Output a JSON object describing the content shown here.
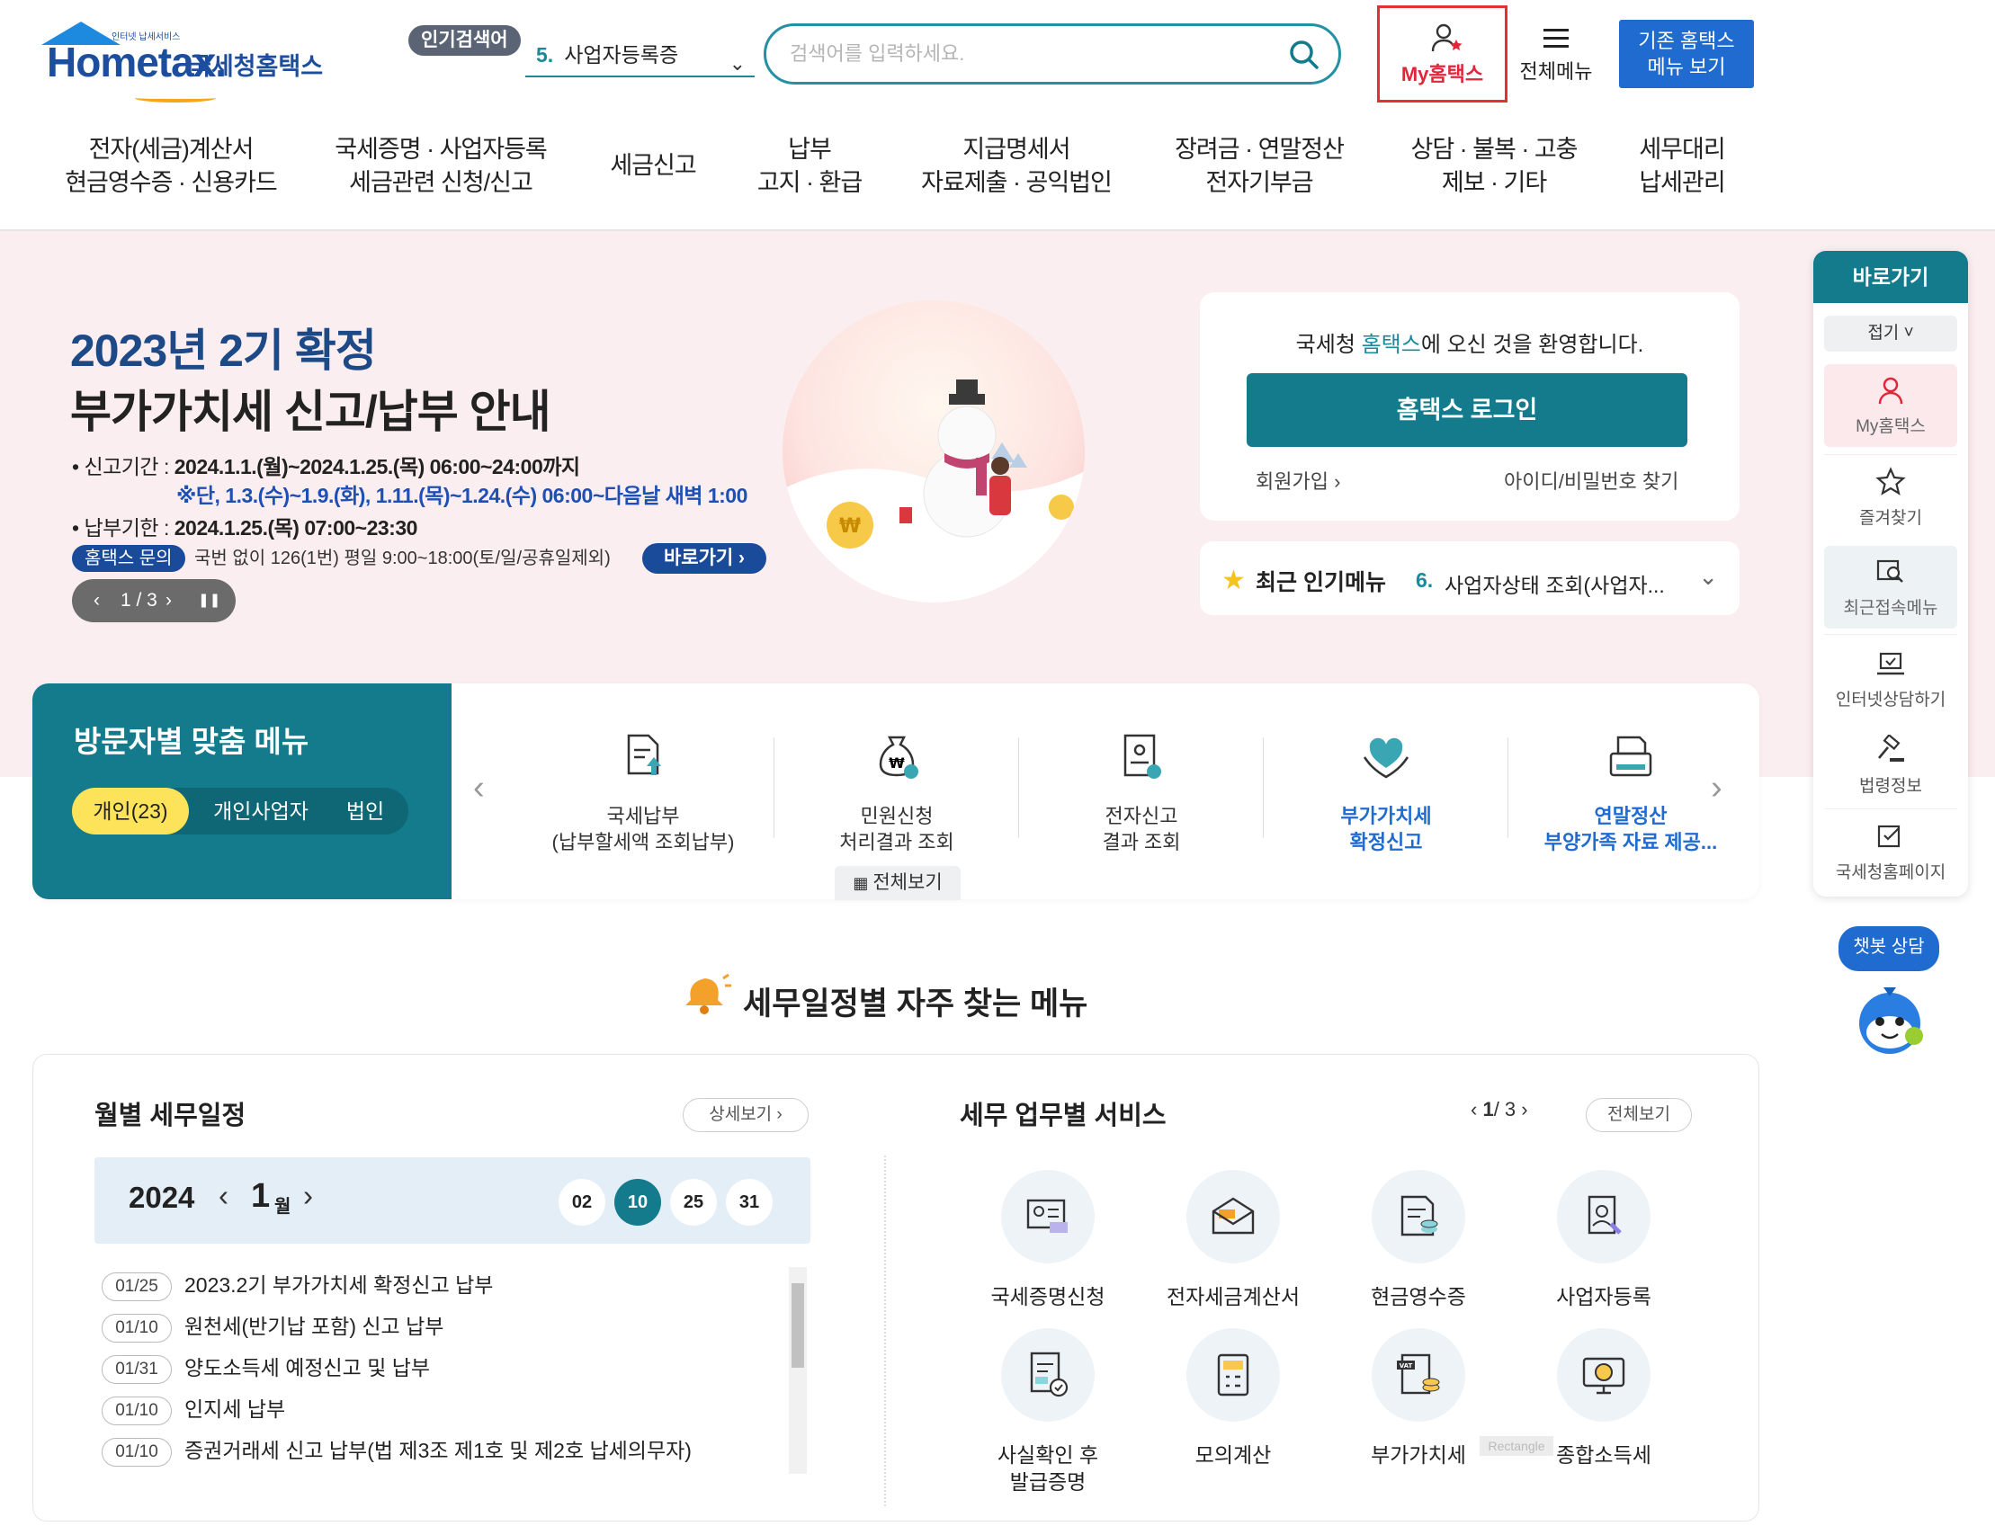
{
  "header": {
    "logo_brand": "Hometax.",
    "logo_sub": "국세청홈택스",
    "logo_tiny": "인터넷 납세서비스",
    "popular_badge": "인기검색어",
    "popular_num": "5.",
    "popular_text": "사업자등록증",
    "search_placeholder": "검색어를 입력하세요.",
    "my_hometax": "My홈택스",
    "all_menu": "전체메뉴",
    "old_menu_line1": "기존 홈택스",
    "old_menu_line2": "메뉴 보기"
  },
  "nav": [
    {
      "l1": "전자(세금)계산서",
      "l2": "현금영수증 · 신용카드"
    },
    {
      "l1": "국세증명 · 사업자등록",
      "l2": "세금관련 신청/신고"
    },
    {
      "l1": "세금신고",
      "l2": ""
    },
    {
      "l1": "납부",
      "l2": "고지 · 환급"
    },
    {
      "l1": "지급명세서",
      "l2": "자료제출 · 공익법인"
    },
    {
      "l1": "장려금 · 연말정산",
      "l2": "전자기부금"
    },
    {
      "l1": "상담 · 불복 · 고충",
      "l2": "제보 · 기타"
    },
    {
      "l1": "세무대리",
      "l2": "납세관리"
    }
  ],
  "hero": {
    "title1": "2023년 2기 확정",
    "title2": "부가가치세 신고/납부 안내",
    "line1_label": "• 신고기간 : ",
    "line1_value": "2024.1.1.(월)~2024.1.25.(목) 06:00~24:00까지",
    "line2": "※단, 1.3.(수)~1.9.(화), 1.11.(목)~1.24.(수) 06:00~다음날 새벽 1:00",
    "line3_label": "• 납부기한 : ",
    "line3_value": "2024.1.25.(목) 07:00~23:30",
    "inquiry_badge": "홈택스 문의",
    "inquiry_text": "국번 없이 126(1번) 평일 9:00~18:00(토/일/공휴일제외)",
    "goto": "바로가기 ›",
    "pager": "1 / 3",
    "pager_prev": "‹",
    "pager_next": "›",
    "pager_pause": "❚❚"
  },
  "login": {
    "welcome_pre": "국세청 ",
    "welcome_hl": "홈택스",
    "welcome_post": "에 오신 것을 환영합니다.",
    "button": "홈택스 로그인",
    "join": "회원가입 ›",
    "find": "아이디/비밀번호 찾기"
  },
  "recent_popular": {
    "title": "최근 인기메뉴",
    "num": "6.",
    "text": "사업자상태 조회(사업자..."
  },
  "visitor": {
    "title": "방문자별 맞춤 메뉴",
    "tabs": [
      "개인(23)",
      "개인사업자",
      "법인"
    ],
    "items": [
      {
        "l1": "국세납부",
        "l2": "(납부할세액 조회납부)",
        "icon": "tax-payment-icon"
      },
      {
        "l1": "민원신청",
        "l2": "처리결과 조회",
        "icon": "money-bag-icon"
      },
      {
        "l1": "전자신고",
        "l2": "결과 조회",
        "icon": "e-filing-icon"
      },
      {
        "l1": "부가가치세",
        "l2": "확정신고",
        "icon": "heart-hands-icon"
      },
      {
        "l1": "연말정산",
        "l2": "부양가족 자료 제공...",
        "icon": "printer-doc-icon"
      }
    ],
    "all": "전체보기",
    "prev": "‹",
    "next": "›"
  },
  "quickbar": {
    "title": "바로가기",
    "fold": "접기 ˅",
    "items": [
      "My홈택스",
      "즐겨찾기",
      "최근접속메뉴",
      "인터넷상담하기",
      "법령정보",
      "국세청홈페이지"
    ],
    "chatbot": "챗봇 상담"
  },
  "schedule_section": {
    "title": "세무일정별 자주 찾는 메뉴"
  },
  "calendar": {
    "title": "월별 세무일정",
    "detail": "상세보기 ›",
    "year": "2024",
    "month": "1",
    "month_unit": "월",
    "days": [
      "02",
      "10",
      "25",
      "31"
    ],
    "selected_day": "10",
    "events": [
      {
        "date": "01/25",
        "text": "2023.2기 부가가치세 확정신고 납부"
      },
      {
        "date": "01/10",
        "text": "원천세(반기납 포함) 신고 납부"
      },
      {
        "date": "01/31",
        "text": "양도소득세 예정신고 및 납부"
      },
      {
        "date": "01/10",
        "text": "인지세 납부"
      },
      {
        "date": "01/10",
        "text": "증권거래세 신고 납부(법 제3조 제1호 및 제2호 납세의무자)"
      }
    ]
  },
  "services": {
    "title": "세무 업무별 서비스",
    "pager_cur": "1",
    "pager_total": "/ 3",
    "all": "전체보기",
    "items": [
      {
        "l1": "국세증명신청",
        "l2": "",
        "icon": "certificate-icon"
      },
      {
        "l1": "전자세금계산서",
        "l2": "",
        "icon": "tax-invoice-icon"
      },
      {
        "l1": "현금영수증",
        "l2": "",
        "icon": "cash-receipt-icon"
      },
      {
        "l1": "사업자등록",
        "l2": "",
        "icon": "business-registration-icon"
      },
      {
        "l1": "사실확인 후",
        "l2": "발급증명",
        "icon": "verified-doc-icon"
      },
      {
        "l1": "모의계산",
        "l2": "",
        "icon": "calculator-icon"
      },
      {
        "l1": "부가가치세",
        "l2": "",
        "icon": "vat-icon"
      },
      {
        "l1": "종합소득세",
        "l2": "",
        "icon": "income-tax-icon"
      }
    ],
    "overlay_label": "Rectangle"
  },
  "colors": {
    "teal": "#137b8c",
    "navy": "#1d4a86",
    "blue": "#1f6bd0",
    "hero_bg": "#fbeef0",
    "highlight": "#e53030"
  }
}
